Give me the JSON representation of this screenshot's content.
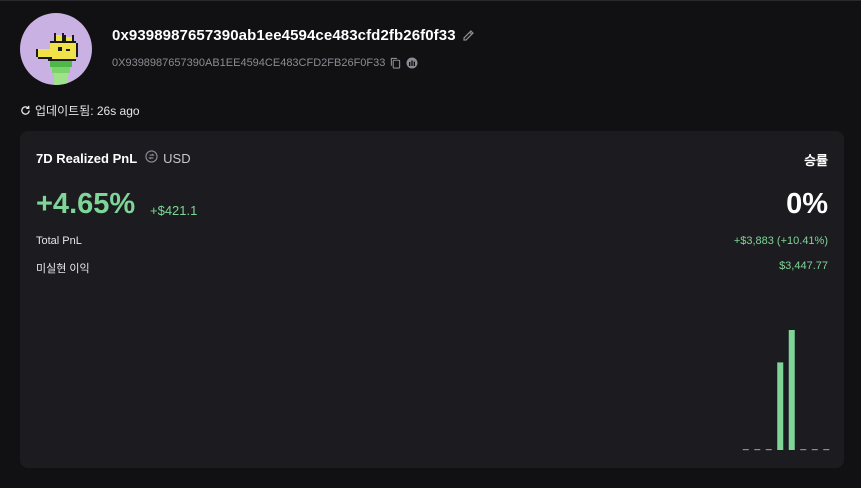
{
  "header": {
    "address": "0x9398987657390ab1ee4594ce483cfd2fb26f0f33",
    "address_upper": "0X9398987657390AB1EE4594CE483CFD2FB26F0F33",
    "updated_text": "업데이트됨: 26s ago",
    "icons": {
      "edit": "pencil-icon",
      "copy": "copy-icon",
      "explorer": "explorer-logo-icon",
      "refresh": "refresh-icon"
    }
  },
  "panel": {
    "title": "7D Realized PnL",
    "currency": "USD",
    "pnl_percent": "+4.65%",
    "pnl_usd": "+$421.1",
    "winrate_label": "승률",
    "winrate_value": "0%",
    "total_pnl_label": "Total PnL",
    "total_pnl_value": "+$3,883 (+10.41%)",
    "unrealized_label": "미실현 이익",
    "unrealized_value": "$3,447.77"
  },
  "chart_data": {
    "type": "bar",
    "values": [
      0,
      0,
      0,
      0.73,
      1.0,
      0,
      0,
      0
    ],
    "color_positive": "#7fd498",
    "color_zero": "#8b8b93"
  },
  "colors": {
    "background": "#111113",
    "panel": "#1c1c20",
    "positive": "#7fd498",
    "muted": "#8b8b93"
  }
}
